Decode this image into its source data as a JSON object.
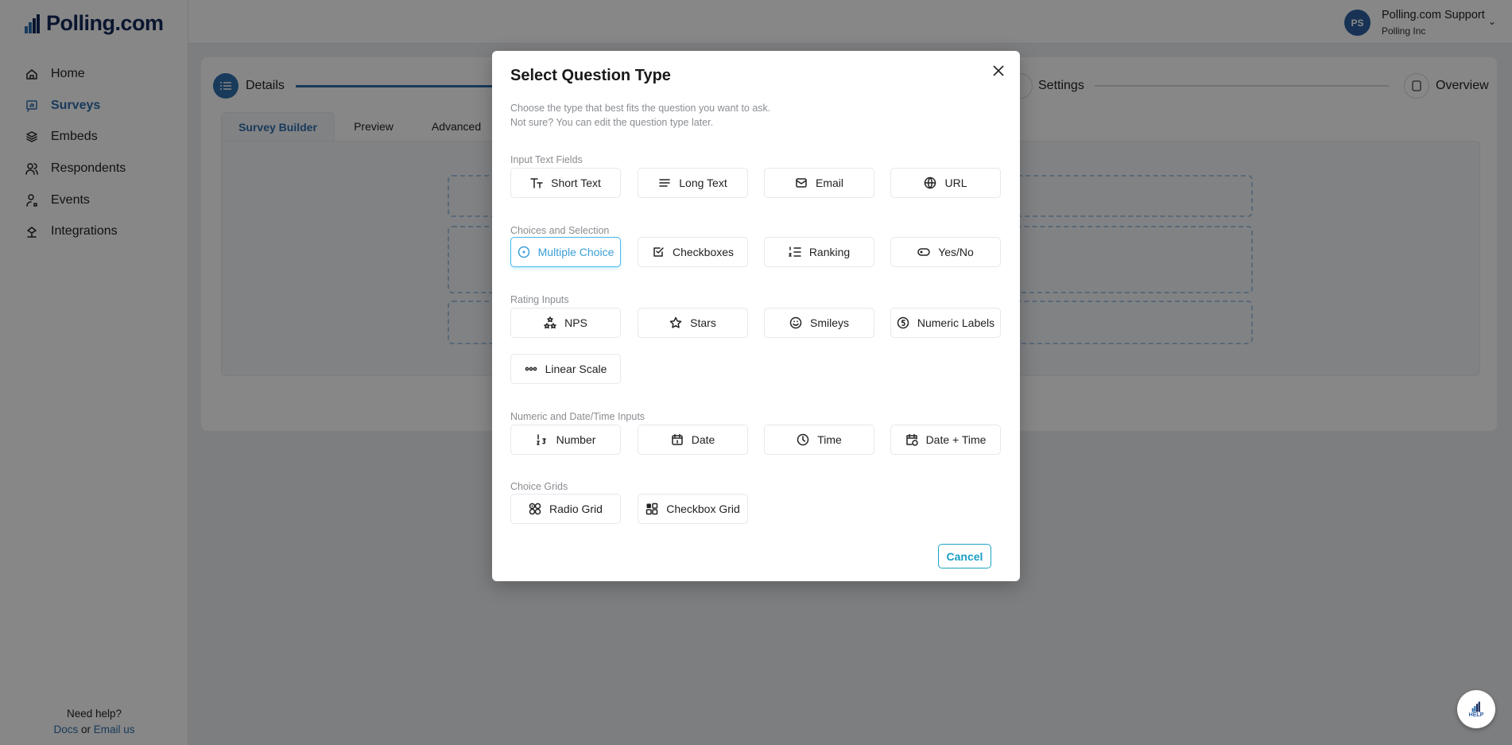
{
  "app": {
    "logo_text": "Polling.com"
  },
  "sidebar": {
    "items": [
      {
        "label": "Home",
        "icon": "home-icon",
        "active": false
      },
      {
        "label": "Surveys",
        "icon": "survey-chart-icon",
        "active": true
      },
      {
        "label": "Embeds",
        "icon": "layers-icon",
        "active": false
      },
      {
        "label": "Respondents",
        "icon": "users-icon",
        "active": false
      },
      {
        "label": "Events",
        "icon": "user-event-icon",
        "active": false
      },
      {
        "label": "Integrations",
        "icon": "integrations-icon",
        "active": false
      }
    ],
    "help": {
      "title": "Need help?",
      "docs": "Docs",
      "or": " or ",
      "email": "Email us"
    }
  },
  "header": {
    "avatar_initials": "PS",
    "user_name": "Polling.com Support",
    "org": "Polling Inc"
  },
  "stepper": {
    "steps": [
      {
        "label": "Details",
        "state": "active"
      },
      {
        "label": "Settings",
        "state": "pending"
      },
      {
        "label": "Overview",
        "state": "pending"
      }
    ]
  },
  "tabs": [
    {
      "label": "Survey Builder",
      "active": true
    },
    {
      "label": "Preview"
    },
    {
      "label": "Advanced"
    }
  ],
  "help_fab": {
    "label": "HELP"
  },
  "modal": {
    "title": "Select Question Type",
    "desc1": "Choose the type that best fits the question you want to ask.",
    "desc2": "Not sure? You can edit the question type later.",
    "sections": [
      {
        "label": "Input Text Fields",
        "rows": [
          [
            {
              "label": "Short Text",
              "icon": "text-size-icon"
            },
            {
              "label": "Long Text",
              "icon": "lines-icon"
            },
            {
              "label": "Email",
              "icon": "mail-icon"
            },
            {
              "label": "URL",
              "icon": "globe-www-icon"
            }
          ]
        ]
      },
      {
        "label": "Choices and Selection",
        "rows": [
          [
            {
              "label": "Multiple Choice",
              "icon": "radio-icon",
              "selected": true
            },
            {
              "label": "Checkboxes",
              "icon": "checkbox-icon"
            },
            {
              "label": "Ranking",
              "icon": "ordered-list-icon"
            },
            {
              "label": "Yes/No",
              "icon": "toggle-icon"
            }
          ]
        ]
      },
      {
        "label": "Rating Inputs",
        "rows": [
          [
            {
              "label": "NPS",
              "icon": "stars-group-icon"
            },
            {
              "label": "Stars",
              "icon": "star-icon"
            },
            {
              "label": "Smileys",
              "icon": "smiley-icon"
            },
            {
              "label": "Numeric Labels",
              "icon": "coin-number-icon"
            }
          ],
          [
            {
              "label": "Linear Scale",
              "icon": "dots-icon"
            }
          ]
        ]
      },
      {
        "label": "Numeric and Date/Time Inputs",
        "rows": [
          [
            {
              "label": "Number",
              "icon": "numbers-icon"
            },
            {
              "label": "Date",
              "icon": "calendar-icon"
            },
            {
              "label": "Time",
              "icon": "clock-icon"
            },
            {
              "label": "Date + Time",
              "icon": "calendar-clock-icon"
            }
          ]
        ]
      },
      {
        "label": "Choice Grids",
        "rows": [
          [
            {
              "label": "Radio Grid",
              "icon": "radio-grid-icon"
            },
            {
              "label": "Checkbox Grid",
              "icon": "checkbox-grid-icon"
            }
          ]
        ]
      }
    ],
    "cancel_label": "Cancel"
  },
  "colors": {
    "primary": "#2f6fad",
    "accent": "#1a9fc5",
    "selected": "#45b8e6"
  }
}
